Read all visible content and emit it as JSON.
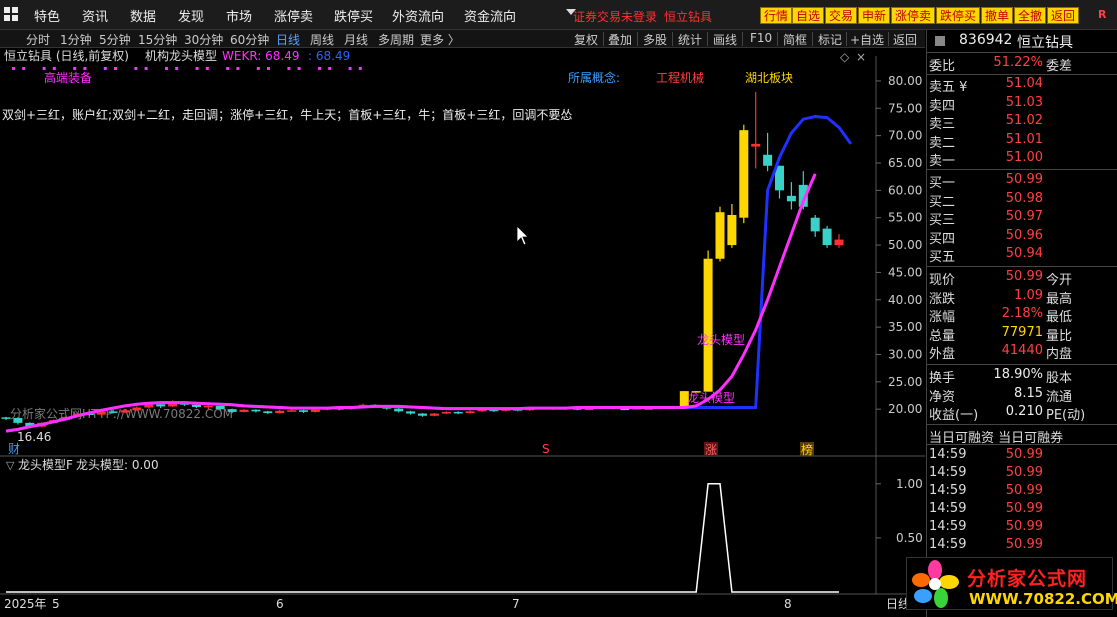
{
  "menu": {
    "items": [
      "特色",
      "资讯",
      "数据",
      "发现",
      "市场",
      "涨停卖",
      "跌停买",
      "外资流向",
      "资金流向"
    ],
    "login_notice": "证券交易未登录",
    "stock_label": "恒立钻具"
  },
  "trade_buttons": [
    "行情",
    "自选",
    "交易",
    "申新",
    "涨停卖",
    "跌停买",
    "撤单",
    "全撤",
    "返回"
  ],
  "panel_r": "R",
  "periods": [
    "分时",
    "1分钟",
    "5分钟",
    "15分钟",
    "30分钟",
    "60分钟",
    "日线",
    "周线",
    "月线",
    "多周期",
    "更多 〉"
  ],
  "tools": [
    "复权",
    "叠加",
    "多股",
    "统计",
    "画线",
    "F10",
    "简框",
    "标记",
    "+自选",
    "返回"
  ],
  "chart_header": {
    "title": "恒立钻具 (日线,前复权)",
    "indicator": "机构龙头模型",
    "wekr_label": "WEKR: 68.49",
    "wekr_value2": ": 68.49"
  },
  "annotations": {
    "concept_prefix": "高端装备",
    "concept_label": "所属概念:",
    "concept1": "工程机械",
    "concept2": "湖北板块",
    "strategy_text": "双剑+三红，账户红;双剑+二红，走回调；涨停+三红，牛上天；首板+三红，牛；首板+三红，回调不要怂",
    "dragon1": "龙头模型",
    "dragon2": "龙头模型",
    "low_price": "16.46",
    "mark_cai": "财",
    "mark_s": "S",
    "mark_zhang": "涨",
    "mark_bang": "榜"
  },
  "watermark": "分析家公式网HTTP://WWW.70822.COM",
  "y_axis": [
    "80.00",
    "75.00",
    "70.00",
    "65.00",
    "60.00",
    "55.00",
    "50.00",
    "45.00",
    "40.00",
    "35.00",
    "30.00",
    "25.00",
    "20.00"
  ],
  "sub_header": {
    "name": "龙头模型F",
    "value": "龙头模型: 0.00"
  },
  "sub_y_axis": [
    "1.00",
    "0.50"
  ],
  "x_axis": {
    "year": "2025年",
    "months": [
      "5",
      "6",
      "7",
      "8"
    ],
    "right_label": "日线"
  },
  "quote": {
    "code": "836942",
    "name": "恒立钻具",
    "weibi_label": "委比",
    "weibi": "51.22%",
    "weicha_label": "委差",
    "asks": [
      {
        "label": "卖五 ¥",
        "price": "51.04"
      },
      {
        "label": "卖四",
        "price": "51.03"
      },
      {
        "label": "卖三",
        "price": "51.02"
      },
      {
        "label": "卖二",
        "price": "51.01"
      },
      {
        "label": "卖一",
        "price": "51.00"
      }
    ],
    "bids": [
      {
        "label": "买一",
        "price": "50.99"
      },
      {
        "label": "买二",
        "price": "50.98"
      },
      {
        "label": "买三",
        "price": "50.97"
      },
      {
        "label": "买四",
        "price": "50.96"
      },
      {
        "label": "买五",
        "price": "50.94"
      }
    ],
    "stats": [
      {
        "l1": "现价",
        "v": "50.99",
        "l2": "今开",
        "color": "red"
      },
      {
        "l1": "涨跌",
        "v": "1.09",
        "l2": "最高",
        "color": "red"
      },
      {
        "l1": "涨幅",
        "v": "2.18%",
        "l2": "最低",
        "color": "red"
      },
      {
        "l1": "总量",
        "v": "77971",
        "l2": "量比",
        "color": "yel"
      },
      {
        "l1": "外盘",
        "v": "41440",
        "l2": "内盘",
        "color": "red"
      }
    ],
    "stats2": [
      {
        "l1": "换手",
        "v": "18.90%",
        "l2": "股本"
      },
      {
        "l1": "净资",
        "v": "8.15",
        "l2": "流通"
      },
      {
        "l1": "收益(一)",
        "v": "0.210",
        "l2": "PE(动)"
      }
    ],
    "margin_header": "当日可融资 当日可融券",
    "ticks": [
      {
        "t": "14:59",
        "p": "50.99"
      },
      {
        "t": "14:59",
        "p": "50.99"
      },
      {
        "t": "14:59",
        "p": "50.99"
      },
      {
        "t": "14:59",
        "p": "50.99"
      },
      {
        "t": "14:59",
        "p": "50.99"
      },
      {
        "t": "14:59",
        "p": "50.99"
      }
    ]
  },
  "logo": {
    "name": "分析家公式网",
    "url": "WWW.70822.COM"
  },
  "chart_data": {
    "type": "candlestick",
    "candles": [
      [
        18.5,
        18.4,
        18.6,
        18.0
      ],
      [
        18.4,
        17.5,
        18.5,
        17.2
      ],
      [
        17.5,
        16.8,
        17.6,
        16.46
      ],
      [
        16.8,
        17.5,
        17.6,
        16.7
      ],
      [
        17.5,
        18.0,
        18.1,
        17.4
      ],
      [
        18.0,
        18.6,
        18.7,
        17.9
      ],
      [
        18.6,
        19.2,
        19.3,
        18.5
      ],
      [
        19.2,
        19.0,
        19.5,
        18.8
      ],
      [
        19.0,
        19.6,
        19.8,
        18.9
      ],
      [
        19.6,
        19.4,
        19.9,
        19.2
      ],
      [
        19.4,
        19.8,
        20.0,
        19.3
      ],
      [
        19.8,
        20.3,
        20.5,
        19.7
      ],
      [
        20.3,
        20.9,
        21.2,
        20.1
      ],
      [
        20.9,
        20.5,
        21.0,
        20.2
      ],
      [
        20.5,
        21.4,
        21.6,
        20.4
      ],
      [
        21.4,
        20.8,
        21.5,
        20.6
      ],
      [
        20.8,
        20.4,
        21.0,
        20.2
      ],
      [
        20.4,
        20.6,
        20.8,
        20.0
      ],
      [
        20.6,
        20.0,
        20.7,
        19.8
      ],
      [
        20.0,
        19.5,
        20.1,
        19.3
      ],
      [
        19.5,
        19.9,
        20.0,
        19.4
      ],
      [
        19.9,
        19.6,
        20.0,
        19.4
      ],
      [
        19.6,
        19.3,
        19.7,
        19.1
      ],
      [
        19.3,
        19.7,
        19.9,
        19.2
      ],
      [
        19.7,
        19.8,
        20.0,
        19.6
      ],
      [
        19.8,
        19.5,
        19.9,
        19.3
      ],
      [
        19.5,
        19.9,
        20.1,
        19.4
      ],
      [
        19.9,
        20.2,
        20.4,
        19.8
      ],
      [
        20.2,
        20.0,
        20.3,
        19.8
      ],
      [
        20.0,
        20.4,
        20.6,
        19.9
      ],
      [
        20.4,
        20.8,
        21.0,
        20.3
      ],
      [
        20.8,
        20.5,
        20.9,
        20.3
      ],
      [
        20.5,
        20.1,
        20.6,
        19.9
      ],
      [
        20.1,
        19.6,
        20.2,
        19.4
      ],
      [
        19.6,
        19.2,
        19.7,
        19.0
      ],
      [
        19.2,
        18.8,
        19.3,
        18.6
      ],
      [
        18.8,
        19.2,
        19.3,
        18.7
      ],
      [
        19.2,
        19.5,
        19.6,
        19.1
      ],
      [
        19.5,
        19.3,
        19.6,
        19.1
      ],
      [
        19.3,
        19.6,
        19.8,
        19.2
      ],
      [
        19.6,
        19.9,
        20.0,
        19.5
      ],
      [
        19.9,
        19.7,
        20.0,
        19.5
      ],
      [
        19.7,
        20.0,
        20.2,
        19.6
      ],
      [
        20.0,
        19.8,
        20.1,
        19.6
      ],
      [
        19.8,
        20.1,
        20.3,
        19.7
      ],
      [
        20.1,
        20.3,
        20.5,
        20.0
      ],
      [
        20.3,
        20.0,
        20.4,
        19.9
      ],
      [
        20.0,
        20.2,
        20.4,
        19.9
      ],
      [
        20.2,
        19.9,
        20.3,
        19.8
      ],
      [
        19.9,
        20.1,
        20.3,
        19.8
      ],
      [
        20.1,
        20.3,
        20.4,
        20.0
      ],
      [
        20.3,
        20.1,
        20.4,
        20.0
      ],
      [
        20.1,
        20.0,
        20.2,
        19.9
      ],
      [
        20.0,
        20.2,
        20.3,
        19.9
      ],
      [
        20.2,
        20.1,
        20.3,
        20.0
      ],
      [
        20.1,
        20.3,
        20.4,
        20.0
      ],
      [
        20.3,
        20.2,
        20.4,
        20.1
      ],
      [
        20.2,
        23.3,
        23.3,
        20.1
      ],
      [
        23.3,
        23.2,
        23.3,
        23.1
      ],
      [
        23.2,
        47.5,
        49.0,
        23.2
      ],
      [
        47.5,
        56.0,
        57.0,
        47.0
      ],
      [
        50.0,
        55.5,
        57.5,
        49.5
      ],
      [
        55.0,
        71.0,
        72.0,
        54.0
      ],
      [
        68.0,
        68.5,
        78.0,
        64.0
      ],
      [
        66.5,
        64.5,
        70.5,
        63.5
      ],
      [
        64.5,
        60.0,
        64.5,
        58.5
      ],
      [
        59.0,
        58.0,
        61.5,
        56.5
      ],
      [
        61.0,
        57.0,
        63.5,
        56.5
      ],
      [
        55.0,
        52.5,
        55.5,
        51.5
      ],
      [
        53.0,
        50.0,
        53.5,
        49.5
      ],
      [
        50.0,
        51.0,
        52.0,
        49.5
      ]
    ],
    "ma_blue": [
      16.0,
      16.3,
      16.8,
      17.2,
      17.7,
      18.2,
      18.8,
      19.3,
      19.8,
      20.2,
      20.6,
      20.9,
      21.1,
      21.2,
      21.2,
      21.2,
      21.1,
      21.0,
      20.9,
      20.8,
      20.6,
      20.5,
      20.4,
      20.3,
      20.2,
      20.2,
      20.2,
      20.2,
      20.3,
      20.3,
      20.4,
      20.5,
      20.5,
      20.5,
      20.4,
      20.3,
      20.2,
      20.1,
      20.1,
      20.1,
      20.1,
      20.1,
      20.1,
      20.1,
      20.2,
      20.2,
      20.2,
      20.2,
      20.3,
      20.3,
      20.3,
      20.3,
      20.3,
      20.3,
      20.3,
      20.3,
      20.3,
      20.3,
      20.3,
      20.3,
      20.3,
      20.3,
      20.3,
      20.3,
      60.0,
      66.0,
      70.5,
      73.0,
      73.5,
      73.3,
      71.5,
      68.5
    ],
    "ma_magenta": [
      16.0,
      16.3,
      16.8,
      17.2,
      17.7,
      18.2,
      18.8,
      19.3,
      19.8,
      20.2,
      20.6,
      20.9,
      21.1,
      21.2,
      21.2,
      21.2,
      21.1,
      21.0,
      20.9,
      20.8,
      20.6,
      20.5,
      20.4,
      20.3,
      20.2,
      20.2,
      20.2,
      20.2,
      20.3,
      20.3,
      20.4,
      20.5,
      20.5,
      20.5,
      20.4,
      20.3,
      20.2,
      20.1,
      20.1,
      20.1,
      20.1,
      20.1,
      20.1,
      20.1,
      20.2,
      20.2,
      20.2,
      20.2,
      20.3,
      20.3,
      20.3,
      20.3,
      20.3,
      20.3,
      20.3,
      20.3,
      20.3,
      20.3,
      20.6,
      21.8,
      23.5,
      26.0,
      30.0,
      34.5,
      40.0,
      46.0,
      52.0,
      58.0,
      63.0
    ],
    "sub_values": [
      0,
      0,
      0,
      0,
      0,
      0,
      0,
      0,
      0,
      0,
      0,
      0,
      0,
      0,
      0,
      0,
      0,
      0,
      0,
      0,
      0,
      0,
      0,
      0,
      0,
      0,
      0,
      0,
      0,
      0,
      0,
      0,
      0,
      0,
      0,
      0,
      0,
      0,
      0,
      0,
      0,
      0,
      0,
      0,
      0,
      0,
      0,
      0,
      0,
      0,
      0,
      0,
      0,
      0,
      0,
      0,
      0,
      0,
      0,
      1,
      1,
      0,
      0,
      0,
      0,
      0,
      0,
      0,
      0,
      0,
      0
    ],
    "ylim": [
      14,
      82
    ],
    "sub_ylim": [
      0,
      1.1
    ]
  }
}
